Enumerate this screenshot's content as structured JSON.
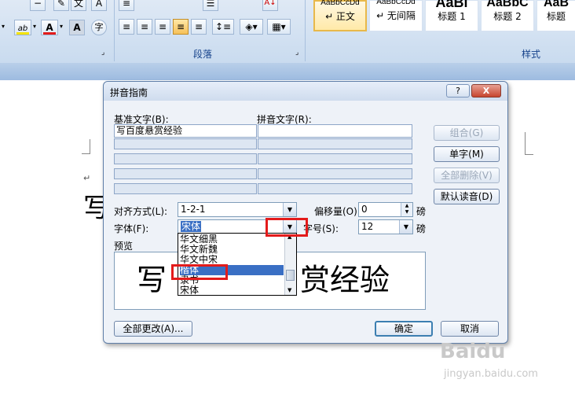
{
  "ribbon": {
    "font_group": {
      "highlight_icon": "ab-highlight-icon",
      "font_color_icon": "a-font-color-icon",
      "char_shading_icon": "a-box-icon",
      "enclose_char_icon": "enclose-char-icon",
      "font_color_hex": "#e31b1b",
      "highlight_hex": "#f4e300"
    },
    "paragraph_group": {
      "label": "段落"
    },
    "styles_group": {
      "label": "样式",
      "tiles": [
        {
          "preview": "AaBbCcDd",
          "name": "↵ 正文"
        },
        {
          "preview": "AaBbCcDd",
          "name": "↵ 无间隔"
        },
        {
          "preview": "AaBl",
          "name": "标题 1"
        },
        {
          "preview": "AaBbC",
          "name": "标题 2"
        },
        {
          "preview": "AaB",
          "name": "标题"
        }
      ]
    }
  },
  "document": {
    "visible_char": "写",
    "paragraph_mark": "↵"
  },
  "dialog": {
    "title": "拼音指南",
    "help_glyph": "?",
    "close_glyph": "X",
    "base_text_label": "基准文字(B):",
    "ruby_text_label": "拼音文字(R):",
    "base_text_value": "写百度悬赏经验",
    "ruby_text_value": "",
    "buttons": {
      "group": "组合(G)",
      "mono": "单字(M)",
      "clear_all": "全部删除(V)",
      "default_reading": "默认读音(D)",
      "apply_all": "全部更改(A)...",
      "ok": "确定",
      "cancel": "取消"
    },
    "alignment_label": "对齐方式(L):",
    "alignment_value": "1-2-1",
    "offset_label": "偏移量(O):",
    "offset_value": "0",
    "offset_unit": "磅",
    "font_label": "字体(F):",
    "font_value": "宋体",
    "size_label": "字号(S):",
    "size_value": "12",
    "size_unit": "磅",
    "preview_label": "预览",
    "preview_text_left": "写",
    "preview_text_right": "赏经验",
    "font_list": {
      "items": [
        "华文细黑",
        "华文新魏",
        "华文中宋",
        "楷体",
        "隶书",
        "宋体"
      ],
      "selected": "楷体"
    }
  },
  "watermark": {
    "brand": "Baidu",
    "sub": "jingyan.baidu.com"
  }
}
